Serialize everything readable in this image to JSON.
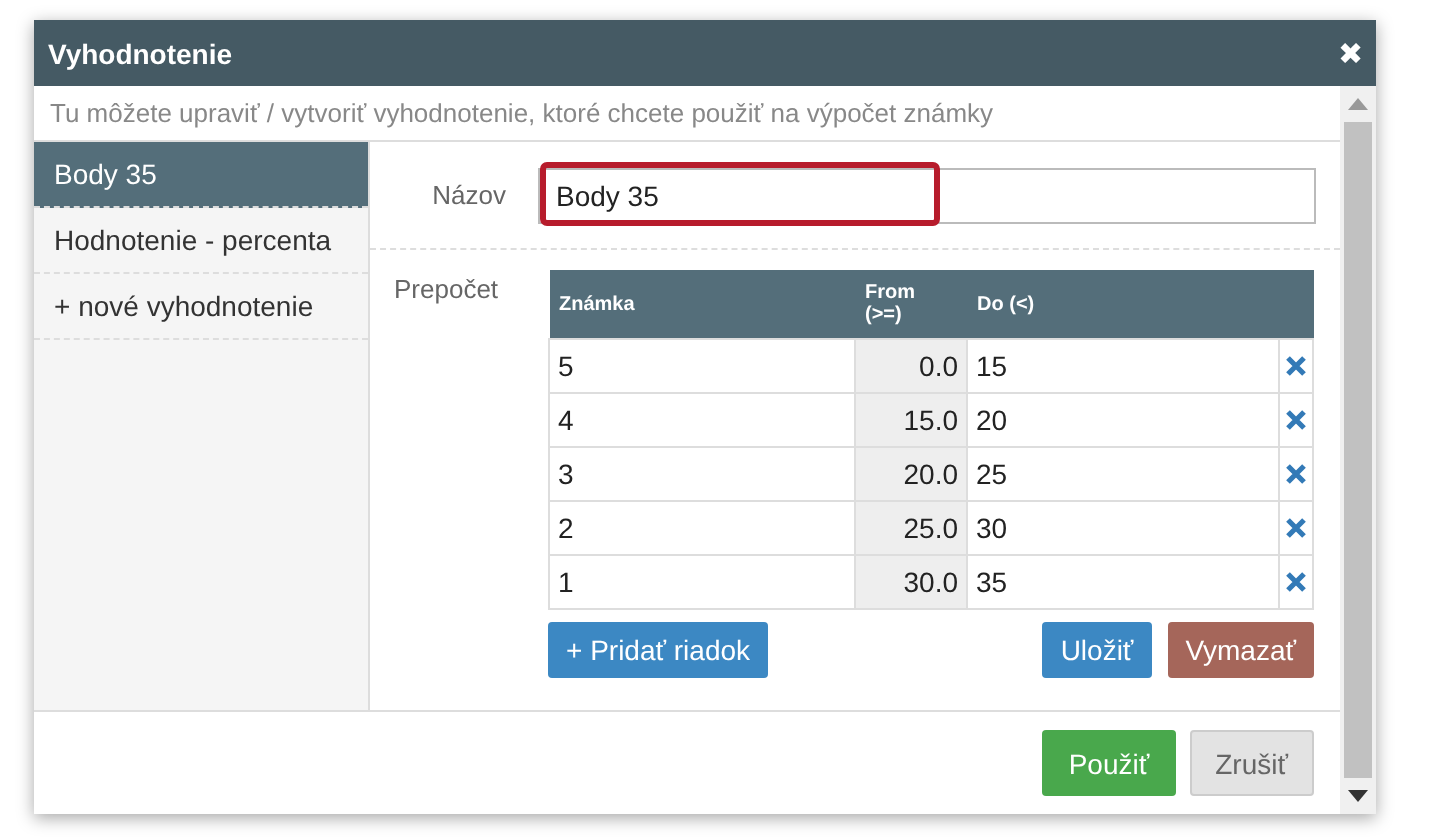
{
  "window": {
    "title": "Vyhodnotenie",
    "close": "✖"
  },
  "hint": "Tu môžete upraviť / vytvoriť vyhodnotenie, ktoré chcete použiť na výpočet známky",
  "sidebar": {
    "items": [
      {
        "label": "Body 35",
        "selected": true
      },
      {
        "label": "Hodnotenie - percenta",
        "selected": false
      },
      {
        "label": "+ nové vyhodnotenie",
        "selected": false
      }
    ]
  },
  "form": {
    "name_label": "Názov",
    "name_value": "Body 35",
    "recalc_label": "Prepočet"
  },
  "table": {
    "columns": [
      "Známka",
      "From (>=)",
      "Do (<)"
    ],
    "rows": [
      {
        "grade": "5",
        "from": "0.0",
        "to": "15"
      },
      {
        "grade": "4",
        "from": "15.0",
        "to": "20"
      },
      {
        "grade": "3",
        "from": "20.0",
        "to": "25"
      },
      {
        "grade": "2",
        "from": "25.0",
        "to": "30"
      },
      {
        "grade": "1",
        "from": "30.0",
        "to": "35"
      }
    ]
  },
  "table_buttons": {
    "add": "+ Pridať riadok",
    "save": "Uložiť",
    "delete": "Vymazať"
  },
  "footer": {
    "apply": "Použiť",
    "cancel": "Zrušiť"
  }
}
